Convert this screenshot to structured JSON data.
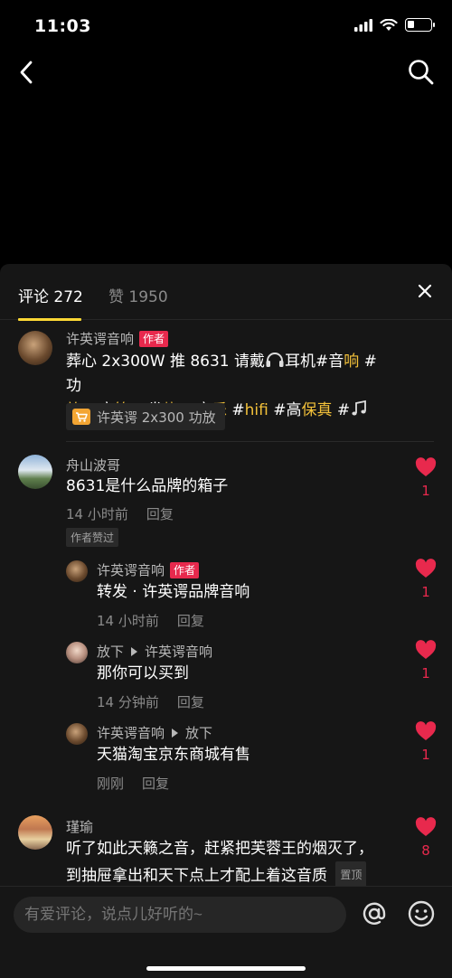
{
  "status_bar": {
    "time": "11:03",
    "battery_level": 0.3
  },
  "tabs": {
    "comments": "评论 272",
    "likes": "赞 1950"
  },
  "colors": {
    "accent": "#fdd835",
    "heart": "#e8294d",
    "hashtag": "#f3c13a"
  },
  "comments": [
    {
      "user": "许英谔音响",
      "badge": "作者",
      "text_parts": [
        "葬心 2x300W 推 8631 请戴",
        "耳机#音",
        "响",
        " #功",
        "放",
        " #音",
        "箱",
        " #发",
        "烧",
        " #音",
        "乐",
        " #",
        "hifi",
        " #高",
        "保真",
        " #"
      ],
      "product": "许英谔 2x300 功放"
    },
    {
      "user": "舟山波哥",
      "text": "8631是什么品牌的箱子",
      "time": "14 小时前",
      "reply": "回复",
      "tag": "作者赞过",
      "likes": "1"
    },
    {
      "user": "许英谔音响",
      "badge": "作者",
      "text": "转发 · 许英谔品牌音响",
      "time": "14 小时前",
      "reply": "回复",
      "likes": "1"
    },
    {
      "user": "放下",
      "reply_to": "许英谔音响",
      "text": "那你可以买到",
      "time": "14 分钟前",
      "reply": "回复",
      "likes": "1"
    },
    {
      "user": "许英谔音响",
      "reply_to": "放下",
      "text": "天猫淘宝京东商城有售",
      "time": "刚刚",
      "reply": "回复",
      "likes": "1"
    },
    {
      "user": "瑾瑜",
      "text_line1": "听了如此天籁之音，赶紧把芙蓉王的烟灭了，",
      "text_line2": "到抽屉拿出和天下点上才配上着这音质",
      "tag": "置顶",
      "likes": "8"
    }
  ],
  "input": {
    "placeholder": "有爱评论，说点儿好听的~"
  }
}
